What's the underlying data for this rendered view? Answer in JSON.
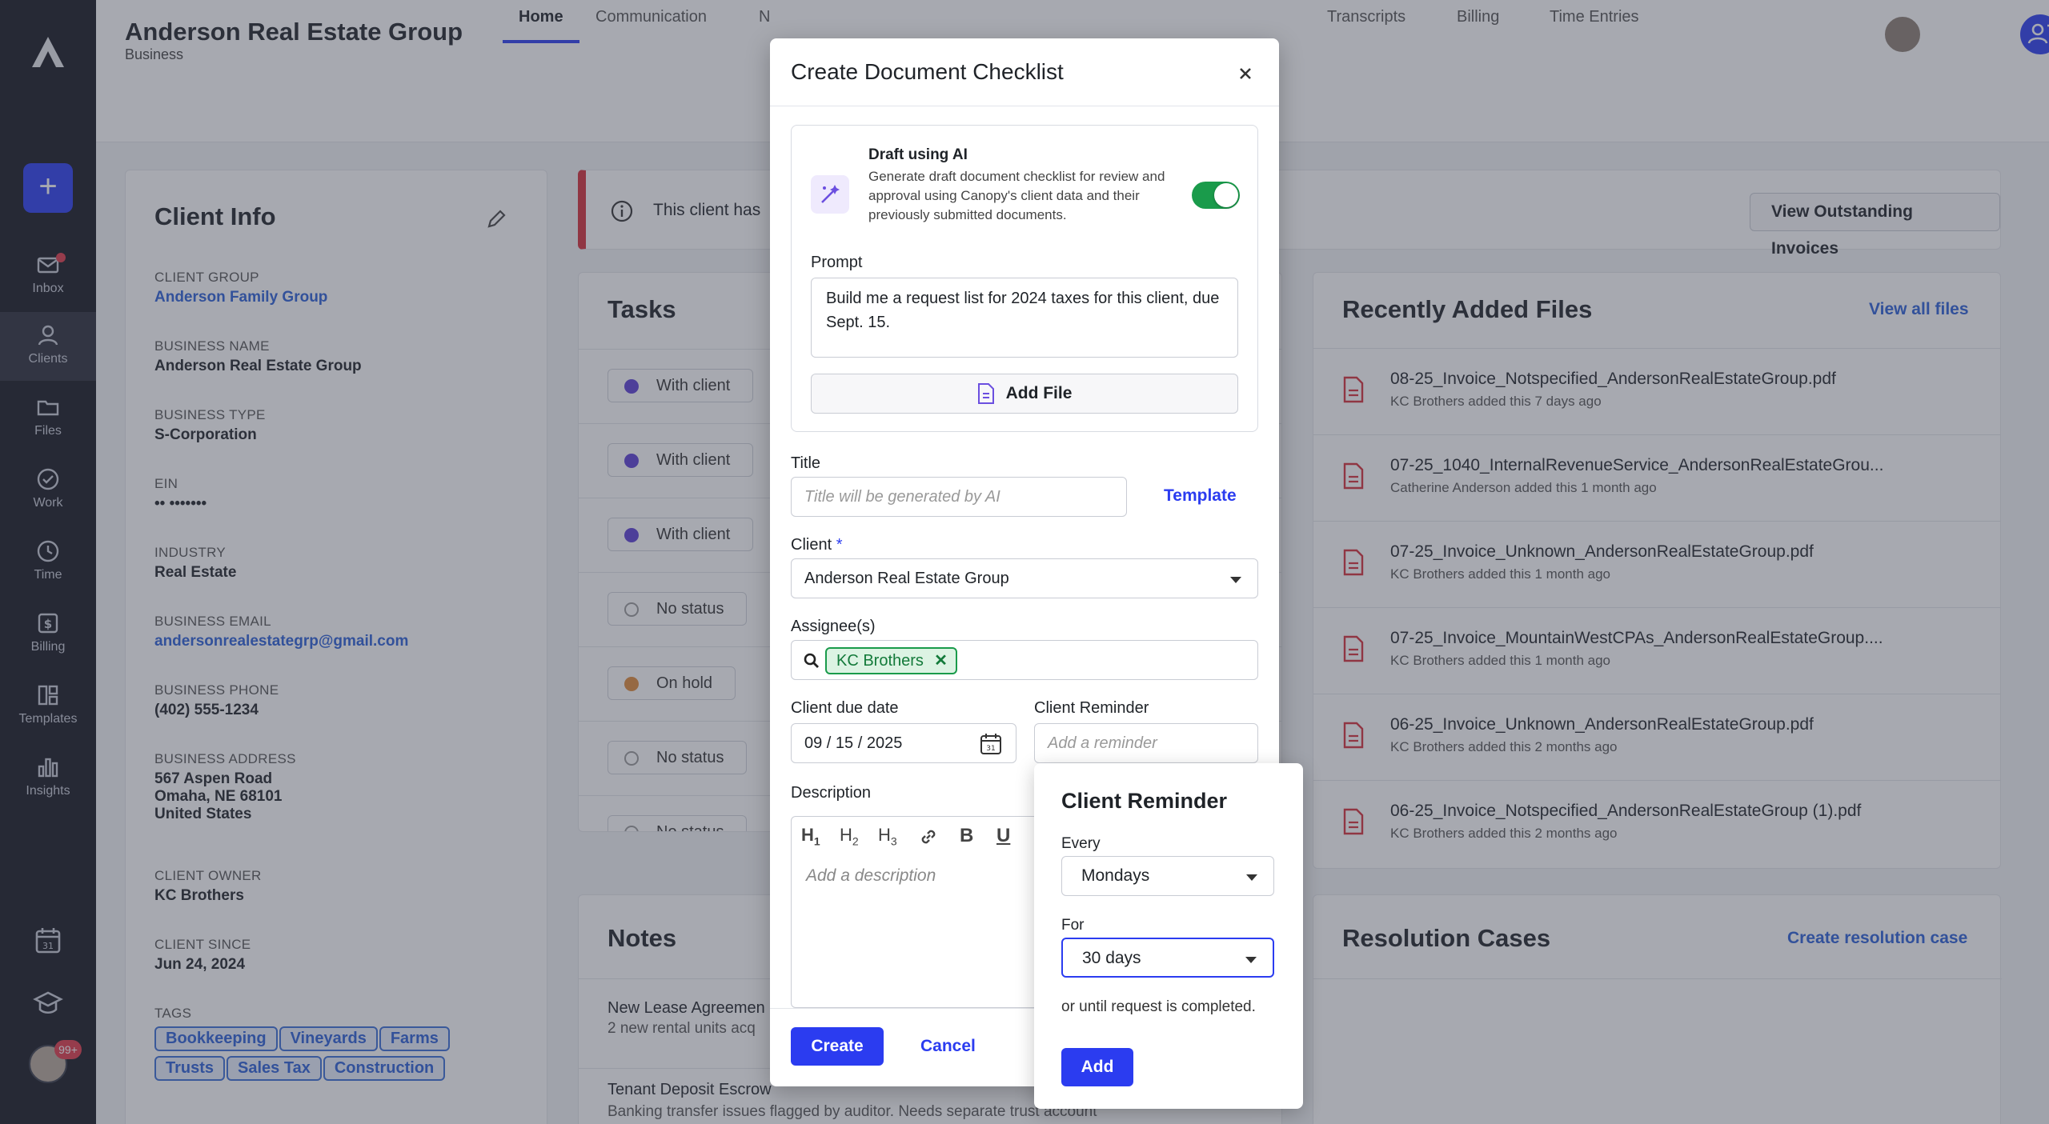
{
  "sidebar": {
    "items": [
      {
        "label": "Inbox",
        "icon": "mail-icon"
      },
      {
        "label": "Clients",
        "icon": "users-icon"
      },
      {
        "label": "Files",
        "icon": "folder-icon"
      },
      {
        "label": "Work",
        "icon": "check-circle-icon"
      },
      {
        "label": "Time",
        "icon": "clock-icon"
      },
      {
        "label": "Billing",
        "icon": "dollar-icon"
      },
      {
        "label": "Templates",
        "icon": "layout-icon"
      },
      {
        "label": "Insights",
        "icon": "bar-chart-icon"
      }
    ],
    "new_label": "+",
    "notification_count": "99+"
  },
  "header": {
    "title": "Anderson Real Estate Group",
    "subtitle": "Business",
    "tabs": [
      "Home",
      "Communication",
      "N",
      "Transcripts",
      "Billing",
      "Time Entries"
    ],
    "active_tab": "Home"
  },
  "client_info": {
    "heading": "Client Info",
    "fields": [
      {
        "label": "CLIENT GROUP",
        "value": "Anderson Family Group"
      },
      {
        "label": "BUSINESS NAME",
        "value": "Anderson Real Estate Group"
      },
      {
        "label": "BUSINESS TYPE",
        "value": "S-Corporation"
      },
      {
        "label": "EIN",
        "value": "•• •••••••"
      },
      {
        "label": "INDUSTRY",
        "value": "Real Estate"
      },
      {
        "label": "BUSINESS EMAIL",
        "value": "andersonrealestategrp@gmail.com"
      },
      {
        "label": "BUSINESS PHONE",
        "value": "(402) 555-1234"
      },
      {
        "label": "BUSINESS ADDRESS",
        "value": "567 Aspen Road",
        "line2": "Omaha, NE 68101",
        "line3": "United States"
      },
      {
        "label": "CLIENT OWNER",
        "value": "KC Brothers"
      },
      {
        "label": "CLIENT SINCE",
        "value": "Jun 24, 2024"
      }
    ],
    "tags_label": "TAGS",
    "tags": [
      "Bookkeeping",
      "Vineyards",
      "Farms",
      "Trusts",
      "Sales Tax",
      "Construction"
    ]
  },
  "banner": {
    "text": "This client has",
    "button": "View Outstanding Invoices"
  },
  "tasks": {
    "heading": "Tasks",
    "statuses": [
      {
        "label": "With client",
        "color": "#5b3fd6"
      },
      {
        "label": "With client",
        "color": "#5b3fd6"
      },
      {
        "label": "With client",
        "color": "#5b3fd6"
      },
      {
        "label": "No status",
        "color": "none"
      },
      {
        "label": "On hold",
        "color": "#e08a3a"
      },
      {
        "label": "No status",
        "color": "none"
      },
      {
        "label": "No status",
        "color": "none"
      }
    ]
  },
  "files": {
    "heading": "Recently Added Files",
    "view_all": "View all files",
    "items": [
      {
        "name": "08-25_Invoice_Notspecified_AndersonRealEstateGroup.pdf",
        "meta": "KC Brothers added this 7 days ago"
      },
      {
        "name": "07-25_1040_InternalRevenueService_AndersonRealEstateGrou...",
        "meta": "Catherine Anderson added this 1 month ago"
      },
      {
        "name": "07-25_Invoice_Unknown_AndersonRealEstateGroup.pdf",
        "meta": "KC Brothers added this 1 month ago"
      },
      {
        "name": "07-25_Invoice_MountainWestCPAs_AndersonRealEstateGroup....",
        "meta": "KC Brothers added this 1 month ago"
      },
      {
        "name": "06-25_Invoice_Unknown_AndersonRealEstateGroup.pdf",
        "meta": "KC Brothers added this 2 months ago"
      },
      {
        "name": "06-25_Invoice_Notspecified_AndersonRealEstateGroup (1).pdf",
        "meta": "KC Brothers added this 2 months ago"
      }
    ]
  },
  "notes": {
    "heading": "Notes",
    "items": [
      {
        "title": "New Lease Agreemen",
        "body": "2 new rental units acq"
      },
      {
        "title": "Tenant Deposit Escrow",
        "body": "Banking transfer issues flagged by auditor. Needs separate trust account"
      }
    ]
  },
  "resolution": {
    "heading": "Resolution Cases",
    "action": "Create resolution case"
  },
  "modal": {
    "title": "Create Document Checklist",
    "ai": {
      "title": "Draft using AI",
      "description": "Generate draft document checklist for review and approval using Canopy's client data and their previously submitted documents.",
      "toggle_on": true
    },
    "prompt_label": "Prompt",
    "prompt_value": "Build me a request list for 2024 taxes for this client, due Sept. 15.",
    "add_file": "Add File",
    "title_label": "Title",
    "title_placeholder": "Title will be generated by AI",
    "template_link": "Template",
    "client_label": "Client",
    "client_required": "*",
    "client_value": "Anderson Real Estate Group",
    "assignees_label": "Assignee(s)",
    "assignee_chip": "KC Brothers",
    "due_label": "Client due date",
    "due_month": "09",
    "due_day": "15",
    "due_year": "2025",
    "reminder_label": "Client Reminder",
    "reminder_placeholder": "Add a reminder",
    "description_label": "Description",
    "description_placeholder": "Add a description",
    "toolbar": [
      "H1",
      "H2",
      "H3",
      "link",
      "B",
      "U"
    ],
    "create": "Create",
    "cancel": "Cancel"
  },
  "reminder_popover": {
    "title": "Client Reminder",
    "every_label": "Every",
    "every_value": "Mondays",
    "for_label": "For",
    "for_value": "30 days",
    "note": "or until request is completed.",
    "add": "Add"
  },
  "colors": {
    "primary": "#2b3cf0",
    "sidebar": "#14161f",
    "success": "#1a9b4b",
    "danger": "#e03a4a",
    "link": "#2b5fd8"
  }
}
